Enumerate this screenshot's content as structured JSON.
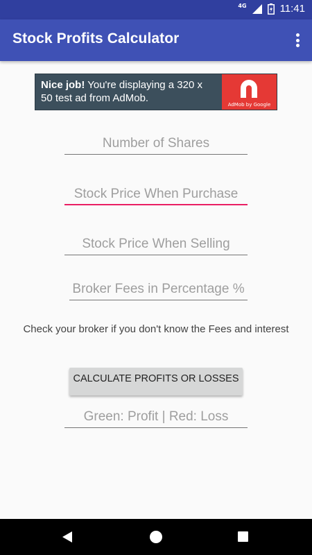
{
  "status_bar": {
    "network": "4G",
    "time": "11:41"
  },
  "app_bar": {
    "title": "Stock Profits Calculator",
    "overflow_icon": "more-vert-icon"
  },
  "ad": {
    "bold_text": "Nice job!",
    "text": " You're displaying a 320 x 50 test ad from AdMob.",
    "brand_caption": "AdMob by Google",
    "brand_color": "#e53935",
    "background_color": "#3c4f5c"
  },
  "form": {
    "shares_placeholder": "Number of Shares",
    "purchase_placeholder": "Stock Price When Purchase",
    "selling_placeholder": "Stock Price When Selling",
    "fees_placeholder": "Broker Fees in Percentage %",
    "hint": "Check your broker if you don't know the Fees and interest",
    "calculate_label": "CALCULATE PROFITS OR LOSSES",
    "result_placeholder": "Green: Profit | Red: Loss",
    "focus_color": "#e91e63"
  },
  "colors": {
    "primary": "#3f51b5",
    "primary_dark": "#303f9f"
  },
  "nav_bar": {
    "back_icon": "back-triangle-icon",
    "home_icon": "home-circle-icon",
    "recents_icon": "recents-square-icon"
  }
}
